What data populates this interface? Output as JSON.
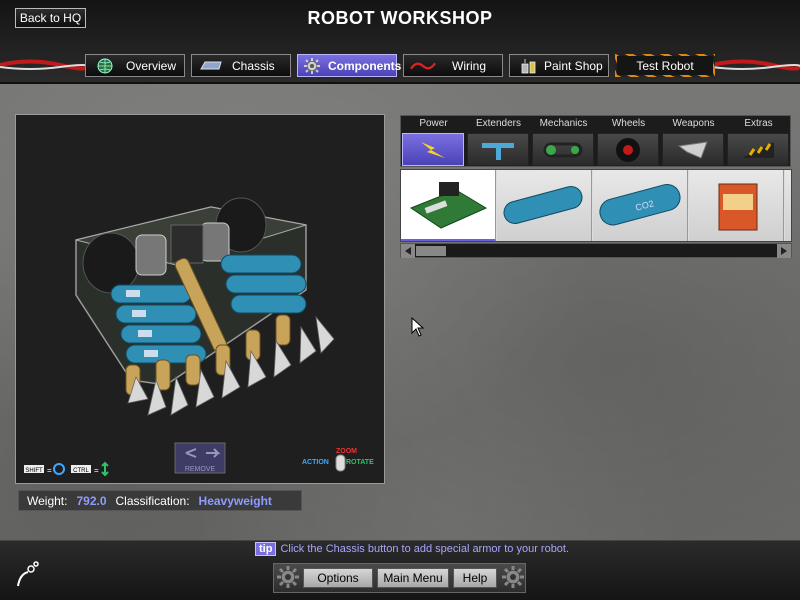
{
  "app": {
    "title": "ROBOT WORKSHOP",
    "back_label": "Back to HQ"
  },
  "nav": {
    "tabs": [
      {
        "label": "Overview",
        "icon": "globe-icon"
      },
      {
        "label": "Chassis",
        "icon": "chassis-icon"
      },
      {
        "label": "Components",
        "icon": "gear-icon",
        "active": true
      },
      {
        "label": "Wiring",
        "icon": "wire-icon"
      },
      {
        "label": "Paint Shop",
        "icon": "paint-can-icon"
      },
      {
        "label": "Test Robot",
        "icon": ""
      }
    ]
  },
  "viewport": {
    "shift_key": "SHIFT",
    "ctrl_key": "CTRL",
    "equals": "=",
    "remove_label": "REMOVE",
    "zoom_label": "ZOOM",
    "action_label": "ACTION",
    "rotate_label": "ROTATE"
  },
  "stats": {
    "weight_label": "Weight:",
    "weight_value": "792.0",
    "class_label": "Classification:",
    "class_value": "Heavyweight"
  },
  "categories": [
    {
      "label": "Power",
      "icon": "lightning-icon",
      "selected": true
    },
    {
      "label": "Extenders",
      "icon": "extender-icon"
    },
    {
      "label": "Mechanics",
      "icon": "chain-icon"
    },
    {
      "label": "Wheels",
      "icon": "wheel-icon"
    },
    {
      "label": "Weapons",
      "icon": "blade-icon"
    },
    {
      "label": "Extras",
      "icon": "hazard-ramp-icon"
    }
  ],
  "items": [
    {
      "name": "circuit-board",
      "selected": true
    },
    {
      "name": "battery-tank-blue"
    },
    {
      "name": "co2-tank-label",
      "text": "CO2"
    },
    {
      "name": "nitro-box"
    }
  ],
  "tip": {
    "badge": "tip",
    "text": "Click the Chassis button to add special armor to your robot."
  },
  "bottom_menu": {
    "options": "Options",
    "main_menu": "Main Menu",
    "help": "Help"
  },
  "colors": {
    "accent": "#6a5fe0",
    "value_text": "#8f9cff",
    "hazard": "#d98a12"
  }
}
